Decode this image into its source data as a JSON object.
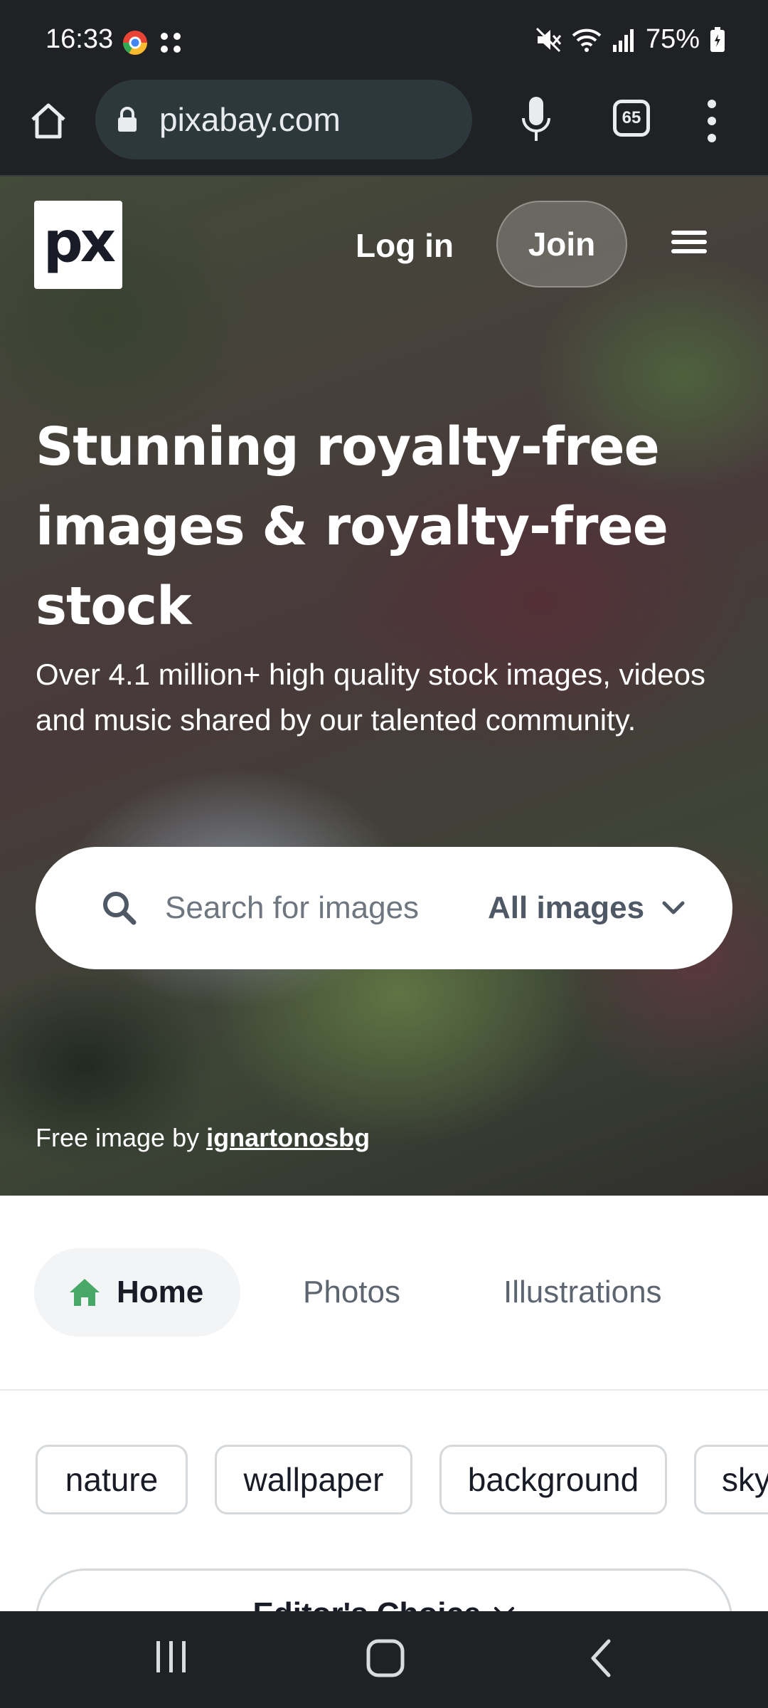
{
  "status_bar": {
    "time": "16:33",
    "battery": "75%",
    "icons": [
      "chrome-icon",
      "app-grid-icon",
      "mute-icon",
      "wifi-icon",
      "signal-icon",
      "battery-icon"
    ]
  },
  "browser": {
    "url": "pixabay.com",
    "tab_count": "65",
    "icons": [
      "home-icon",
      "lock-icon",
      "mic-icon",
      "tabs-icon",
      "more-vert-icon"
    ]
  },
  "header": {
    "logo_text": "px",
    "login_label": "Log in",
    "join_label": "Join"
  },
  "hero": {
    "title": "Stunning royalty-free images & royalty-free stock",
    "subtitle": "Over 4.1 million+ high quality stock images, videos and music shared by our talented community.",
    "search_placeholder": "Search for images",
    "search_type": "All images",
    "credit_prefix": "Free image by",
    "credit_author": "ignartonosbg"
  },
  "tabs": [
    {
      "label": "Home",
      "active": true
    },
    {
      "label": "Photos",
      "active": false
    },
    {
      "label": "Illustrations",
      "active": false
    }
  ],
  "tags": [
    "nature",
    "wallpaper",
    "background",
    "sky"
  ],
  "editors_choice_label": "Editor's Choice",
  "colors": {
    "chrome_dark": "#1f2124",
    "url_pill": "#2d383d",
    "brand_green": "#48a868",
    "text_dark": "#191b26",
    "text_muted": "#5d6570"
  }
}
